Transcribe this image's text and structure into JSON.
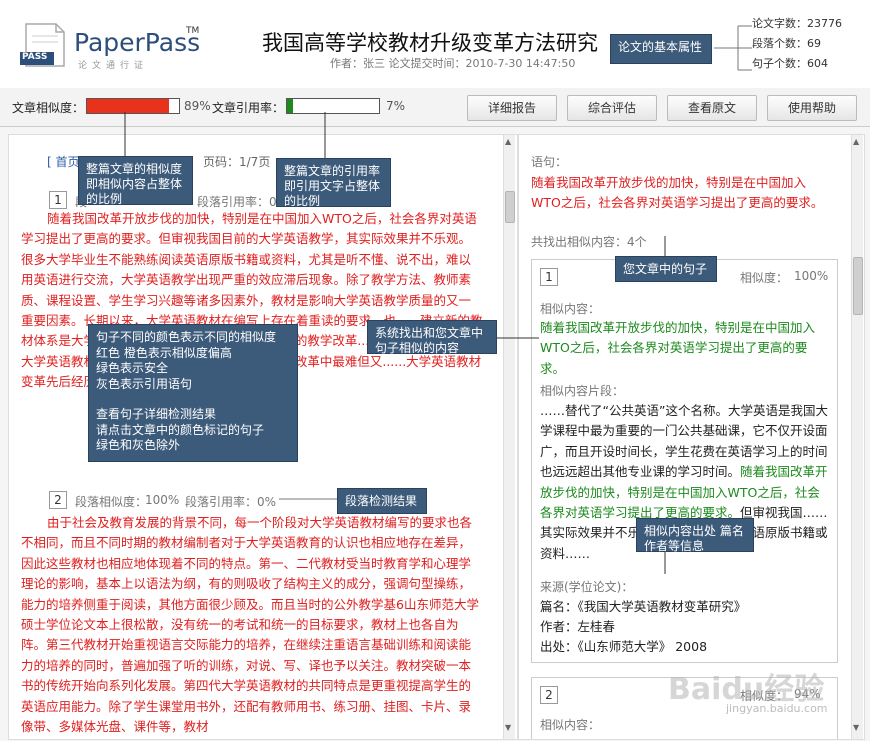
{
  "header": {
    "logo_text": "PaperPass",
    "logo_tm": "TM",
    "logo_badge": "PASS",
    "logo_sub": "论文通行证",
    "title": "我国高等学校教材升级变革方法研究",
    "meta": "作者：张三  论文提交时间：2010-7-30 14:47:50",
    "stats": [
      "论文字数：23776",
      "段落个数：69",
      "句子个数：604"
    ],
    "note": "论文的基本属性"
  },
  "toolbar": {
    "similarity_label": "文章相似度：",
    "similarity_value": "89%",
    "similarity_fraction": 0.89,
    "citation_label": "文章引用率：",
    "citation_value": "7%",
    "citation_fraction": 0.07,
    "buttons": [
      "详细报告",
      "综合评估",
      "查看原文",
      "使用帮助"
    ],
    "colors": {
      "similarity": "#e8321c",
      "citation": "#1c8a1c"
    }
  },
  "left": {
    "pager_prefix": "[ 首页",
    "pager_suffix": "页码：1/7页",
    "p1": {
      "num": "1",
      "stats_partial": "段落引用率：0%",
      "first_char": "段",
      "text": "随着我国改革开放步伐的加快，特别是在中国加入WTO之后，社会各界对英语学习提出了更高的要求。但审视我国目前的大学英语教学，其实际效果并不乐观。很多大学毕业生不能熟练阅读英语原版书籍或资料，尤其是听不懂、说不出，难以用英语进行交流，大学英语教学出现严重的效应滞后现象。除了教学方法、教师素质、课程设置、学生学习兴趣等诸多因素外，教材是影响大学英语教学质量的又一重要因素。长期以来，大学英语教材在编写上存在着重读的要求，也......建立新的教材体系是大学英......的教材体系做基础，大学英语的教学改革......某种意义上来说，大学英语教材体系的改......也是当今大学英语教学改革中最难但又......大学英语教材变革先后经历了四个阶段，逐渐走向......"
    },
    "p2": {
      "num": "2",
      "sim_label": "段落相似度：",
      "sim_value": "100%",
      "cite": "段落引用率：0%",
      "text": "由于社会及教育发展的背景不同，每一个阶段对大学英语教材编写的要求也各不相同，而且不同时期的教材编制者对于大学英语教育的认识也相应地存在差异，因此这些教材也相应地体现着不同的特点。第一、二代教材受当时教育学和心理学理论的影响，基本上以语法为纲，有的则吸收了结构主义的成分，强调句型操练，能力的培养侧重于阅读，其他方面很少顾及。而且当时的公外教学基6山东师范大学硕士学位论文本上很松散，没有统一的考试和统一的目标要求，教材上也各自为阵。第三代教材开始重视语言交际能力的培养，在继续注重语言基础训练和阅读能力的培养的同时，普遍加强了听的训练，对说、写、译也予以关注。教材突破一本书的传统开始向系列化发展。第四代大学英语教材的共同特点是更重视提高学生的英语应用能力。除了学生课堂用书外，还配有教师用书、练习册、挂图、卡片、录像带、多媒体光盘、课件等，教材"
    }
  },
  "right": {
    "sentence_label": "语句：",
    "sentence": "随着我国改革开放步伐的加快，特别是在中国加入WTO之后，社会各界对英语学习提出了更高的要求。",
    "found": "共找出相似内容：4个",
    "card1": {
      "num": "1",
      "sim_label": "相似度：",
      "sim_value": "100%",
      "content_label": "相似内容：",
      "content": "随着我国改革开放步伐的加快，特别是在中国加入WTO之后，社会各界对英语学习提出了更高的要求。",
      "fragment_label": "相似内容片段：",
      "fragment_dark": "……替代了“公共英语”这个名称。大学英语是我国大学课程中最为重要的一门公共基础课，它不仅开设面广，而且开设时间长，学生花费在英语学习上的时间也远远超出其他专业课的学习时间。",
      "fragment_green": "随着我国改革开放步伐的加快，特别是在中国加入WTO之后，社会各界对英语学习提出了更高的要求。",
      "fragment_tail": "但审视我国……其实际效果并不乐观。很多……阅读英语原版书籍或资料……",
      "source_label": "来源(学位论文)：",
      "source_title": "篇名：《我国大学英语教材变革研究》",
      "source_author": "作者：左桂春",
      "source_pub": "出处：《山东师范大学》 2008"
    },
    "card2": {
      "num": "2",
      "sim_label": "相似度：",
      "sim_value": "94%",
      "content_label": "相似内容："
    }
  },
  "notes": {
    "n1": "整篇文章的相似度即相似内容占整体的比例",
    "n2": "整篇文章的引用率即引用文字占整体的比例",
    "n3": [
      "句子不同的颜色表示不同的相似度",
      "红色 橙色表示相似度偏高",
      "绿色表示安全",
      "灰色表示引用语句",
      "",
      "查看句子详细检测结果",
      "请点击文章中的颜色标记的句子",
      "绿色和灰色除外"
    ],
    "n4": "系统找出和您文章中句子相似的内容",
    "n5": "您文章中的句子",
    "n6": "段落检测结果",
    "n7": "相似内容出处 篇名 作者等信息"
  },
  "watermark": {
    "brand": "Baidu经验",
    "url": "jingyan.baidu.com"
  }
}
